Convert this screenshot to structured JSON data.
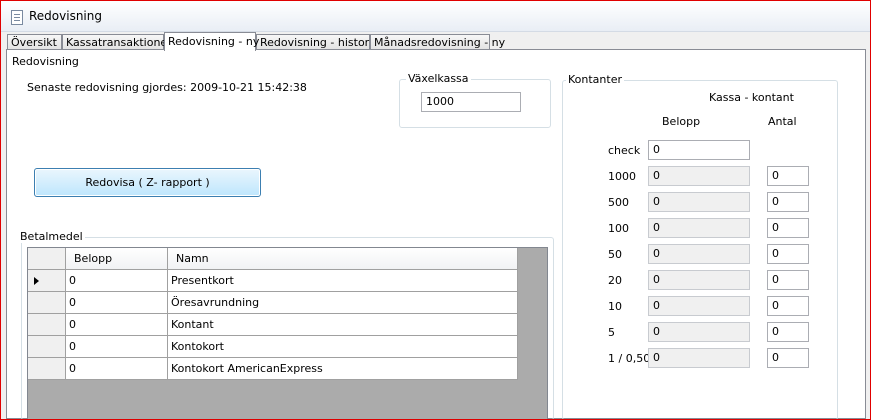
{
  "window": {
    "title": "Redovisning"
  },
  "tabs": [
    {
      "label": "Översikt",
      "active": false
    },
    {
      "label": "Kassatransaktioner",
      "active": false
    },
    {
      "label": "Redovisning - ny",
      "active": true
    },
    {
      "label": "Redovisning - historik",
      "active": false
    },
    {
      "label": "Månadsredovisning - ny",
      "active": false
    }
  ],
  "page": {
    "group_label": "Redovisning",
    "last_report_text": "Senaste redovisning gjordes: 2009-10-21 15:42:38",
    "vaxelkassa": {
      "label": "Växelkassa",
      "value": "1000"
    },
    "report_button": "Redovisa      ( Z- rapport )"
  },
  "betalmedel": {
    "label": "Betalmedel",
    "columns": [
      "Belopp",
      "Namn"
    ],
    "rows": [
      {
        "belopp": "0",
        "namn": "Presentkort"
      },
      {
        "belopp": "0",
        "namn": "Öresavrundning"
      },
      {
        "belopp": "0",
        "namn": "Kontant"
      },
      {
        "belopp": "0",
        "namn": "Kontokort"
      },
      {
        "belopp": "0",
        "namn": "Kontokort AmericanExpress"
      }
    ]
  },
  "kontanter": {
    "label": "Kontanter",
    "heading": "Kassa - kontant",
    "col_belopp": "Belopp",
    "col_antal": "Antal",
    "rows": [
      {
        "label": "check",
        "belopp": "0",
        "antal": null
      },
      {
        "label": "1000",
        "belopp": "0",
        "antal": "0"
      },
      {
        "label": "500",
        "belopp": "0",
        "antal": "0"
      },
      {
        "label": "100",
        "belopp": "0",
        "antal": "0"
      },
      {
        "label": "50",
        "belopp": "0",
        "antal": "0"
      },
      {
        "label": "20",
        "belopp": "0",
        "antal": "0"
      },
      {
        "label": "10",
        "belopp": "0",
        "antal": "0"
      },
      {
        "label": "5",
        "belopp": "0",
        "antal": "0"
      },
      {
        "label": "1 / 0,50",
        "belopp": "0",
        "antal": "0"
      }
    ]
  }
}
